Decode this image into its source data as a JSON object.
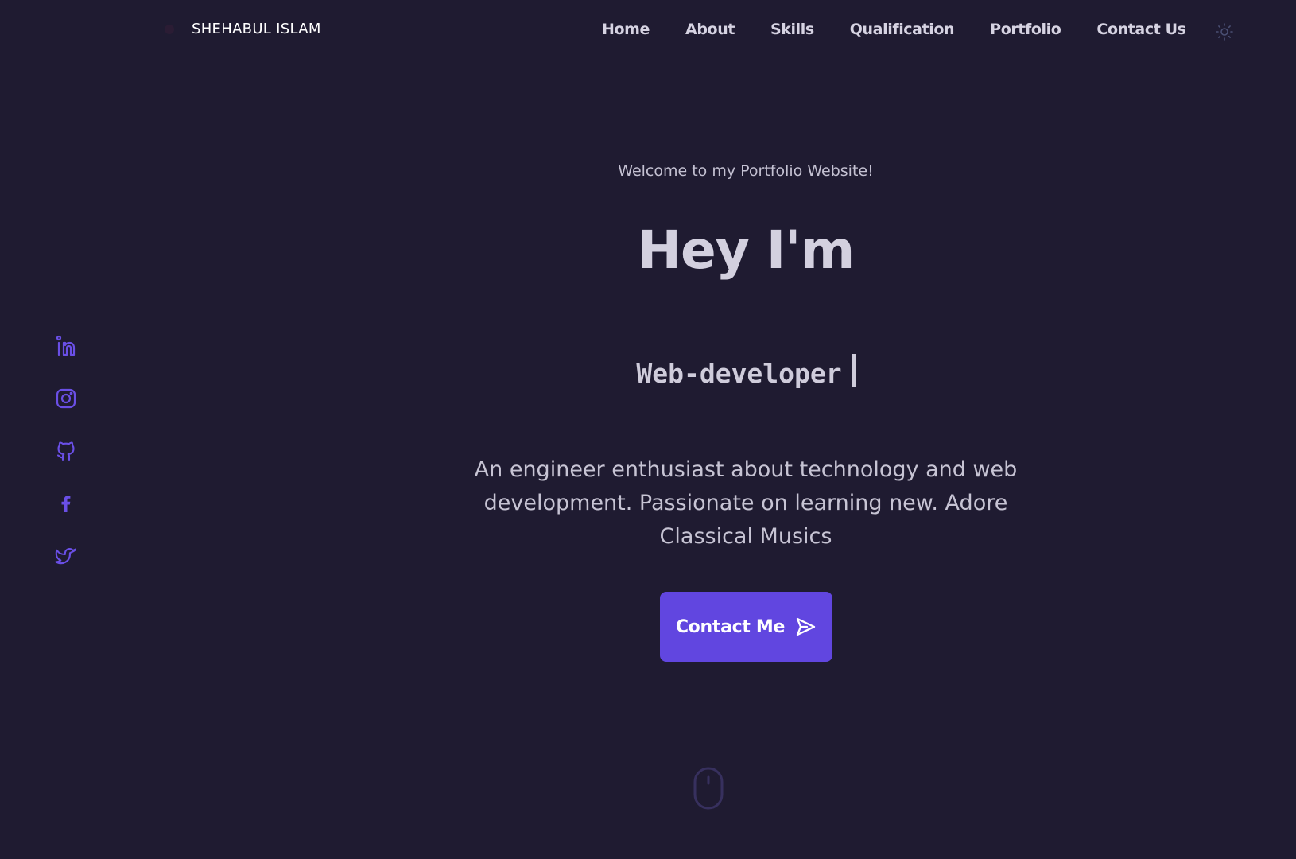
{
  "header": {
    "logo_text": "SHEHABUL ISLAM",
    "nav": [
      {
        "label": "Home"
      },
      {
        "label": "About"
      },
      {
        "label": "Skills"
      },
      {
        "label": "Qualification"
      },
      {
        "label": "Portfolio"
      },
      {
        "label": "Contact Us"
      }
    ],
    "theme_icon": "sun-icon"
  },
  "social": [
    {
      "icon": "linkedin-icon"
    },
    {
      "icon": "instagram-icon"
    },
    {
      "icon": "github-icon"
    },
    {
      "icon": "facebook-icon"
    },
    {
      "icon": "twitter-icon"
    }
  ],
  "hero": {
    "welcome": "Welcome to my Portfolio Website!",
    "greeting": "Hey I'm",
    "role": "Web-developer",
    "description": "An engineer enthusiast about technology and web development. Passionate on learning new. Adore Classical Musics",
    "cta_label": "Contact Me",
    "cta_icon": "send-icon",
    "scroll_icon": "mouse-icon"
  },
  "colors": {
    "background": "#1f1b31",
    "accent": "#6146e0",
    "text": "#d3d0df"
  }
}
